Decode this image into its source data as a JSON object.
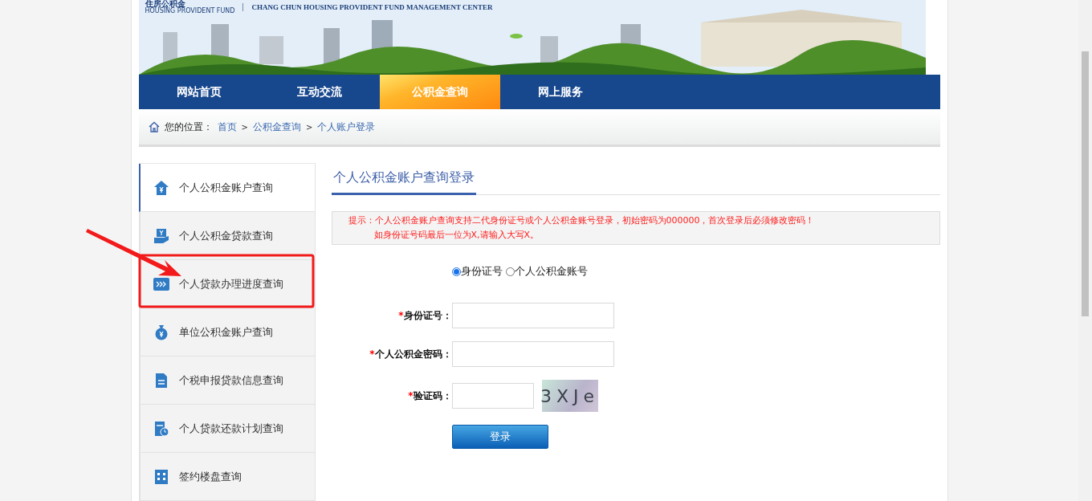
{
  "header": {
    "logo_text": "住房公积金",
    "logo_subtitle": "HOUSING PROVIDENT FUND",
    "center_name": "CHANG CHUN HOUSING PROVIDENT FUND MANAGEMENT CENTER"
  },
  "nav": [
    {
      "label": "网站首页",
      "selected": false
    },
    {
      "label": "互动交流",
      "selected": false
    },
    {
      "label": "公积金查询",
      "selected": true
    },
    {
      "label": "网上服务",
      "selected": false
    }
  ],
  "breadcrumb": {
    "prefix": "您的位置：",
    "links": [
      "首页",
      "公积金查询",
      "个人账户登录"
    ],
    "separator": ">"
  },
  "sidebar": [
    {
      "label": "个人公积金账户查询",
      "selected": true
    },
    {
      "label": "个人公积金贷款查询",
      "selected": false
    },
    {
      "label": "个人贷款办理进度查询",
      "selected": false
    },
    {
      "label": "单位公积金账户查询",
      "selected": false
    },
    {
      "label": "个税申报贷款信息查询",
      "selected": false
    },
    {
      "label": "个人贷款还款计划查询",
      "selected": false
    },
    {
      "label": "签约楼盘查询",
      "selected": false
    }
  ],
  "main": {
    "title": "个人公积金账户查询登录",
    "notice": [
      "提示：个人公积金账户查询支持二代身份证号或个人公积金账号登录，初始密码为000000，首次登录后必须修改密码！",
      "如身份证号码最后一位为X,请输入大写X。"
    ],
    "login_type": [
      {
        "label": "身份证号",
        "selected": true
      },
      {
        "label": "个人公积金账号",
        "selected": false
      }
    ],
    "fields": [
      {
        "required_mark": "*",
        "label": "身份证号：",
        "kind": "text"
      },
      {
        "required_mark": "*",
        "label": "个人公积金密码：",
        "kind": "password"
      },
      {
        "required_mark": "*",
        "label": "验证码：",
        "kind": "captcha",
        "captcha": "3XJe"
      }
    ],
    "submit": "登录"
  }
}
